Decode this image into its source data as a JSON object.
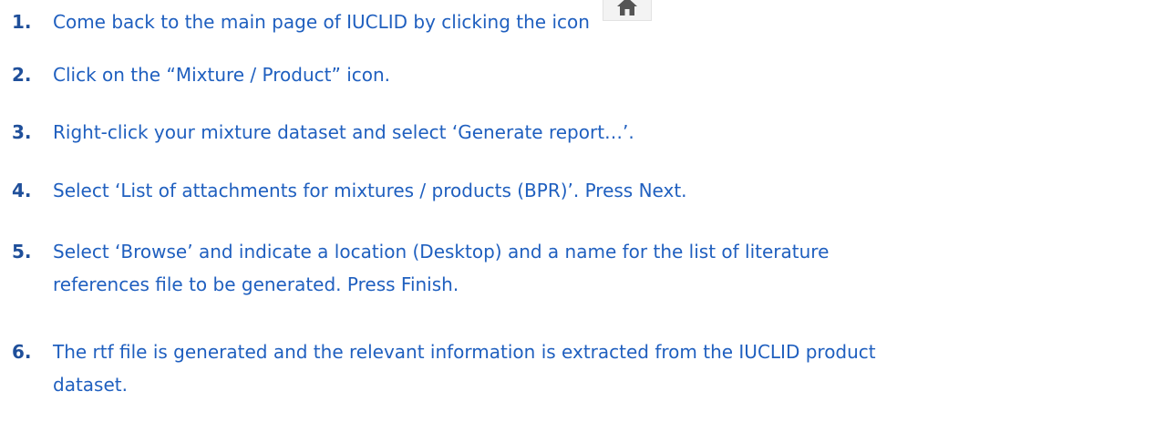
{
  "steps": [
    {
      "number": "1.",
      "text": "Come back to the main page of IUCLID by clicking the icon"
    },
    {
      "number": "2.",
      "text": "Click on the “Mixture / Product” icon."
    },
    {
      "number": "3.",
      "text": "Right-click your mixture dataset and select ‘Generate report…’."
    },
    {
      "number": "4.",
      "text": "Select ‘List of attachments for mixtures / products (BPR)’. Press Next."
    },
    {
      "number": "5.",
      "line1": "Select ‘Browse’ and indicate a location (Desktop) and a name for the list of literature",
      "line2": "references file to be generated. Press Finish."
    },
    {
      "number": "6.",
      "line1": "The rtf file is generated and the relevant information is extracted from the IUCLID product",
      "line2": "dataset."
    }
  ],
  "icons": {
    "home": "home-icon"
  },
  "colors": {
    "text": "#1f5fbf",
    "number": "#1f4f9a",
    "icon_bg": "#f3f3f3",
    "icon_fg": "#555555"
  }
}
